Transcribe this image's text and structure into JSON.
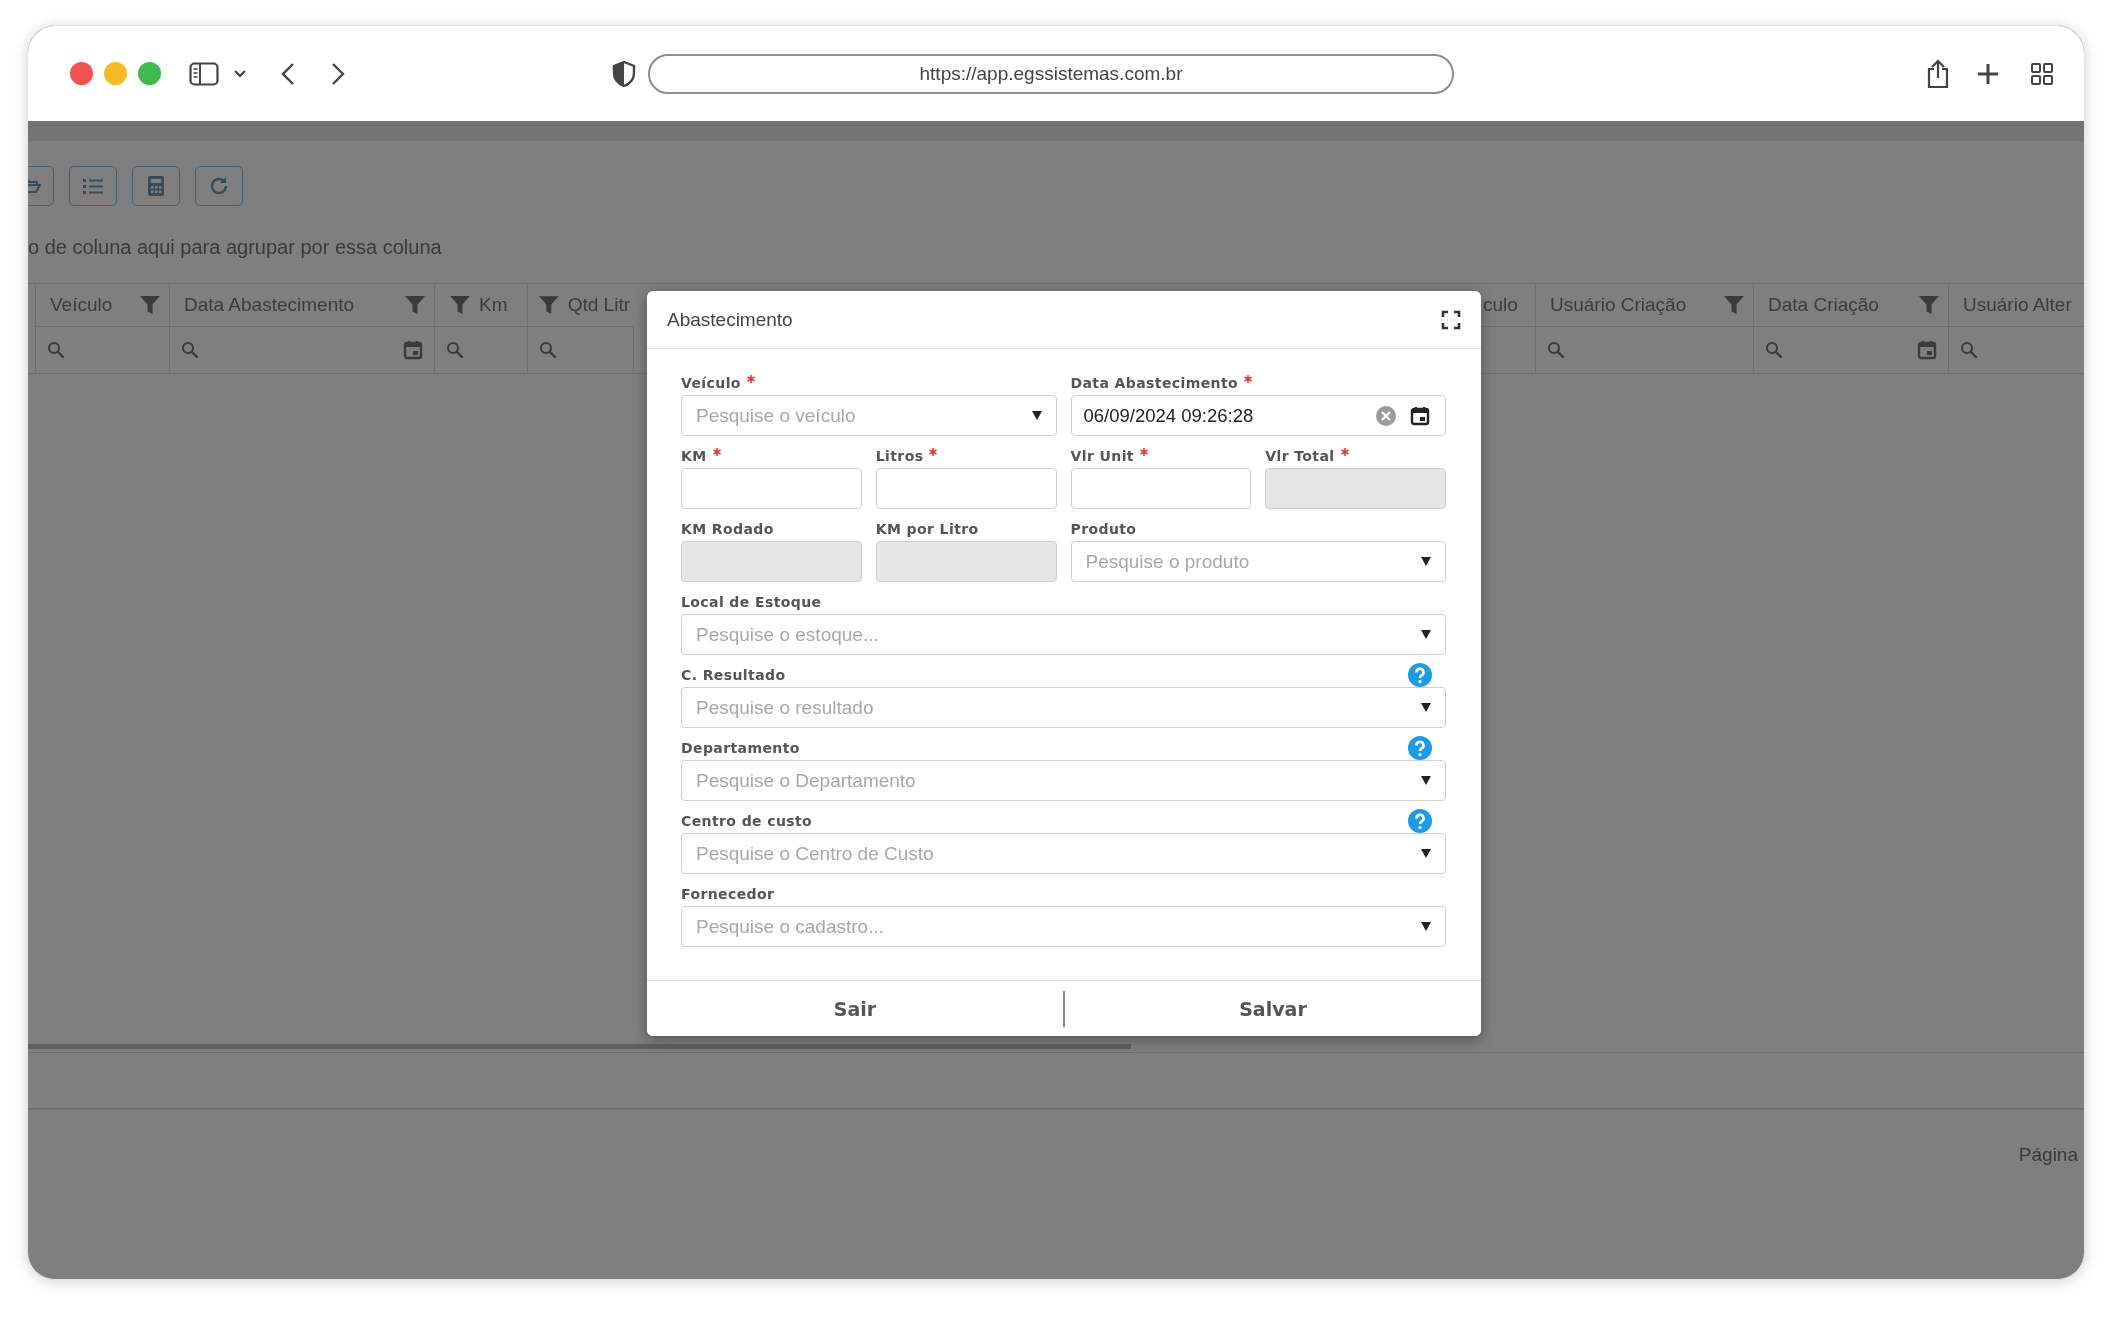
{
  "browser": {
    "url": "https://app.egssistemas.com.br"
  },
  "grid": {
    "group_hint": "o de coluna aqui para agrupar por essa coluna",
    "columns_left": [
      {
        "label": "Veículo",
        "filter": true,
        "filter_first": false,
        "search": true,
        "calendar": false
      },
      {
        "label": "Data Abastecimento",
        "filter": true,
        "filter_first": false,
        "search": true,
        "calendar": true
      },
      {
        "label": "Km",
        "filter": true,
        "filter_first": true,
        "search": true,
        "calendar": false
      },
      {
        "label": "Qtd Litr",
        "filter": true,
        "filter_first": true,
        "search": true,
        "calendar": false
      }
    ],
    "columns_right": [
      {
        "label": "culo",
        "filter": false,
        "search": false,
        "calendar": false
      },
      {
        "label": "Usuário Criação",
        "filter": true,
        "filter_first": false,
        "search": true,
        "calendar": false
      },
      {
        "label": "Data Criação",
        "filter": true,
        "filter_first": false,
        "search": true,
        "calendar": true
      },
      {
        "label": "Usuário Alter",
        "filter": false,
        "search": true,
        "calendar": false
      }
    ],
    "pager_label": "Página"
  },
  "dialog": {
    "title": "Abastecimento",
    "fields": [
      {
        "label": "Veículo",
        "required": true,
        "help": false,
        "kind": "select",
        "placeholder": "Pesquise o veículo"
      },
      {
        "label": "Data Abastecimento",
        "required": true,
        "help": false,
        "kind": "datetime",
        "value": "06/09/2024 09:26:28"
      },
      {
        "label": "KM",
        "required": true,
        "help": false,
        "kind": "text",
        "disabled": false
      },
      {
        "label": "Litros",
        "required": true,
        "help": false,
        "kind": "text",
        "disabled": false
      },
      {
        "label": "Vlr Unit",
        "required": true,
        "help": false,
        "kind": "text",
        "disabled": false
      },
      {
        "label": "Vlr Total",
        "required": true,
        "help": false,
        "kind": "text",
        "disabled": true
      },
      {
        "label": "KM Rodado",
        "required": false,
        "help": false,
        "kind": "text",
        "disabled": true
      },
      {
        "label": "KM por Litro",
        "required": false,
        "help": false,
        "kind": "text",
        "disabled": true
      },
      {
        "label": "Produto",
        "required": false,
        "help": false,
        "kind": "select",
        "placeholder": "Pesquise o produto"
      },
      {
        "label": "Local de Estoque",
        "required": false,
        "help": false,
        "kind": "select",
        "placeholder": "Pesquise o estoque..."
      },
      {
        "label": "C. Resultado",
        "required": false,
        "help": true,
        "kind": "select",
        "placeholder": "Pesquise o resultado"
      },
      {
        "label": "Departamento",
        "required": false,
        "help": true,
        "kind": "select",
        "placeholder": "Pesquise o Departamento"
      },
      {
        "label": "Centro de custo",
        "required": false,
        "help": true,
        "kind": "select",
        "placeholder": "Pesquise o Centro de Custo"
      },
      {
        "label": "Fornecedor",
        "required": false,
        "help": false,
        "kind": "select",
        "placeholder": "Pesquise o cadastro..."
      }
    ],
    "buttons": [
      {
        "label": "Sair"
      },
      {
        "label": "Salvar"
      }
    ]
  }
}
